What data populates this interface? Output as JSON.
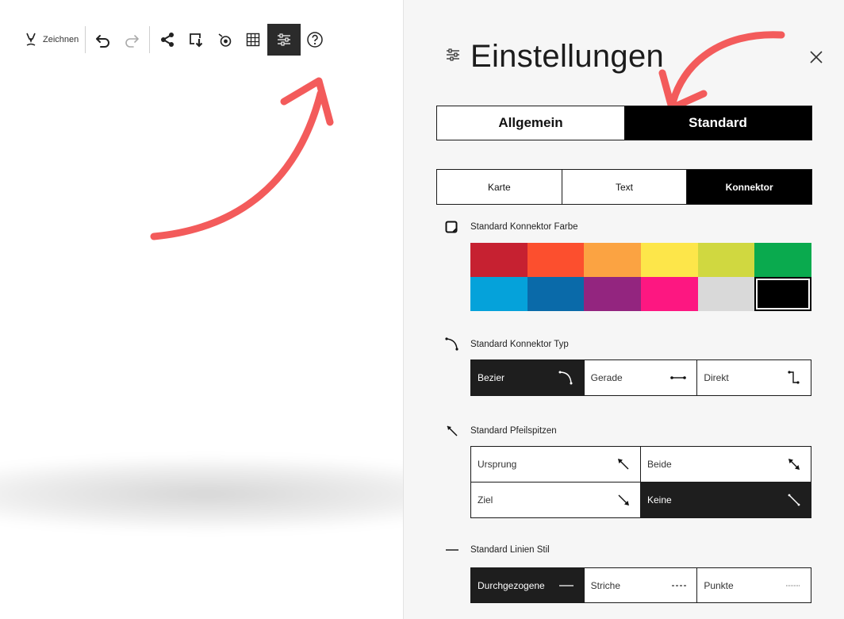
{
  "toolbar": {
    "draw_label": "Zeichnen",
    "icons": [
      "pen-icon",
      "undo-icon",
      "redo-icon",
      "share-icon",
      "export-icon",
      "focus-icon",
      "grid-icon",
      "settings-sliders-icon",
      "help-icon"
    ],
    "active_tool": "settings-sliders-icon"
  },
  "settings": {
    "title": "Einstellungen",
    "tabs": [
      {
        "label": "Allgemein",
        "active": false
      },
      {
        "label": "Standard",
        "active": true
      }
    ],
    "subtabs": [
      {
        "label": "Karte",
        "active": false
      },
      {
        "label": "Text",
        "active": false
      },
      {
        "label": "Konnektor",
        "active": true
      }
    ],
    "color": {
      "label": "Standard Konnektor Farbe",
      "swatches": [
        "#c62131",
        "#fc4f2e",
        "#fba342",
        "#fde64a",
        "#d0d840",
        "#0aaa4e",
        "#05a2da",
        "#0a6aa9",
        "#93257f",
        "#fd1781",
        "#d9d9d9",
        "#000000"
      ],
      "selected": "#000000"
    },
    "type": {
      "label": "Standard Konnektor Typ",
      "options": [
        {
          "label": "Bezier",
          "icon": "bezier-curve-icon",
          "active": true
        },
        {
          "label": "Gerade",
          "icon": "straight-line-icon",
          "active": false
        },
        {
          "label": "Direkt",
          "icon": "elbow-connector-icon",
          "active": false
        }
      ]
    },
    "arrowheads": {
      "label": "Standard Pfeilspitzen",
      "options": [
        {
          "label": "Ursprung",
          "icon": "arrow-origin-icon",
          "active": false
        },
        {
          "label": "Beide",
          "icon": "arrow-both-icon",
          "active": false
        },
        {
          "label": "Ziel",
          "icon": "arrow-target-icon",
          "active": false
        },
        {
          "label": "Keine",
          "icon": "arrow-none-icon",
          "active": true
        }
      ]
    },
    "linestyle": {
      "label": "Standard Linien Stil",
      "options": [
        {
          "label": "Durchgezogene",
          "icon": "solid-line-icon",
          "active": true
        },
        {
          "label": "Striche",
          "icon": "dashed-line-icon",
          "active": false
        },
        {
          "label": "Punkte",
          "icon": "dotted-line-icon",
          "active": false
        }
      ]
    }
  },
  "colors": {
    "annotation_arrow": "#f35b5b",
    "active_fill": "#1e1e1e"
  }
}
